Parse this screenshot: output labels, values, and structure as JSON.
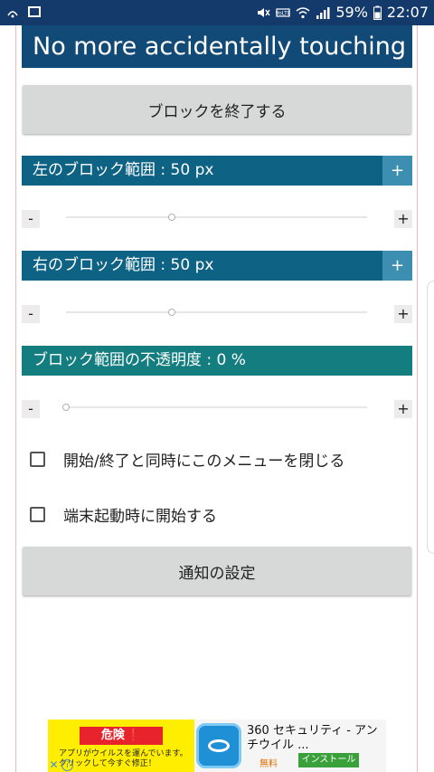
{
  "status_bar": {
    "battery": "59%",
    "time": "22:07",
    "icons": [
      "wifi-calling-icon",
      "screenshot-icon",
      "mute-icon",
      "volte-icon",
      "wifi-icon",
      "signal-icon",
      "battery-icon"
    ]
  },
  "title": "No more accidentally touching",
  "stop_block_button": "ブロックを終了する",
  "left_range": {
    "label": "左のブロック範囲 : 50 px",
    "plus": "+",
    "minus": "-",
    "value_fraction": 0.35,
    "header_color": "#0e6283"
  },
  "right_range": {
    "label": "右のブロック範囲 : 50 px",
    "plus": "+",
    "minus": "-",
    "value_fraction": 0.35,
    "header_color": "#0e6283"
  },
  "opacity": {
    "label": "ブロック範囲の不透明度 : 0 %",
    "minus": "-",
    "plus": "+",
    "value_fraction": 0.0,
    "header_color": "#137d7f"
  },
  "checkbox_close_menu": {
    "label": "開始/終了と同時にこのメニューを閉じる",
    "checked": false
  },
  "checkbox_start_on_boot": {
    "label": "端末起動時に開始する",
    "checked": false
  },
  "notification_settings_button": "通知の設定",
  "ad": {
    "danger_label": "危険",
    "warning_text": "アプリがウイルスを運んでいます。クリックして今すぐ修正！",
    "app_title": "360 セキュリティ - アンチウイル ...",
    "price": "無料",
    "install": "インストール",
    "close": "✕",
    "info": "i"
  },
  "colors": {
    "status_bar": "#143a6b",
    "title_bar": "#114a77",
    "plus_button": "#3c8fb0",
    "button_bg": "#d7d8d8"
  }
}
